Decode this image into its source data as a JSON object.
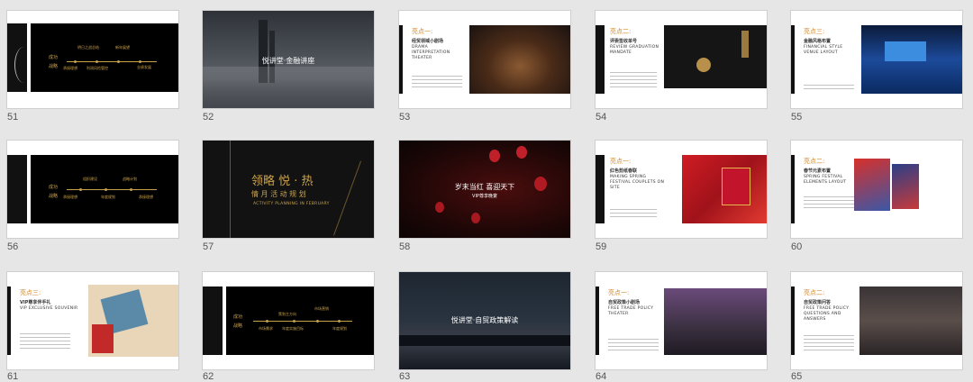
{
  "slides": [
    {
      "num": "51",
      "labels": [
        "成功",
        "战略",
        "明日之战总结",
        "新年展望",
        "承接理想",
        "利润风险管控",
        "业绩发展"
      ]
    },
    {
      "num": "52",
      "title": "悦讲堂·金融讲座"
    },
    {
      "num": "53",
      "heading": "亮点一:",
      "sub": "经贸领域小剧场",
      "en": "DRAMA INTERPRETATION THEATER"
    },
    {
      "num": "54",
      "heading": "亮点二:",
      "sub": "评委签收单号",
      "en": "REVIEW GRADUATION MANDATE"
    },
    {
      "num": "55",
      "heading": "亮点三:",
      "sub": "金融风格布置",
      "en": "FINANCIAL STYLE VENUE LAYOUT"
    },
    {
      "num": "56",
      "labels": [
        "成功",
        "战略",
        "组织建设",
        "承接理想",
        "战略计划",
        "年度规划",
        "承接理想"
      ]
    },
    {
      "num": "57",
      "title_main": "领略 悦 · 热",
      "title_sub": "情 月 活 动 规 划",
      "en": "ACTIVITY PLANNING IN FEBRUARY"
    },
    {
      "num": "58",
      "title": "岁末当红 喜迎天下",
      "sub": "VIP尊享晚宴"
    },
    {
      "num": "59",
      "heading": "亮点一:",
      "sub": "红色剪纸春联",
      "en": "MAKING SPRING FESTIVAL COUPLETS ON SITE"
    },
    {
      "num": "60",
      "heading": "亮点二:",
      "sub": "春节元素布置",
      "en": "SPRING FESTIVAL ELEMENTS LAYOUT"
    },
    {
      "num": "61",
      "heading": "亮点三:",
      "sub": "VIP尊享伴手礼",
      "en": "VIP EXCLUSIVE SOUVENIR"
    },
    {
      "num": "62",
      "labels": [
        "成功",
        "战略",
        "策划主方向",
        "年度实施目标",
        "市场营销",
        "市场需求",
        "年度规划"
      ]
    },
    {
      "num": "63",
      "title": "悦讲堂·自贸政策解读"
    },
    {
      "num": "64",
      "heading": "亮点一:",
      "sub": "自贸政策小剧场",
      "en": "FREE TRADE POLICY THEATER"
    },
    {
      "num": "65",
      "heading": "亮点二:",
      "sub": "自贸政策问答",
      "en": "FREE TRADE POLICY QUESTIONS AND ANSWERS"
    }
  ],
  "colors": {
    "gold": "#c9a24d",
    "orange": "#d28a2c",
    "bg": "#e6e6e6"
  }
}
